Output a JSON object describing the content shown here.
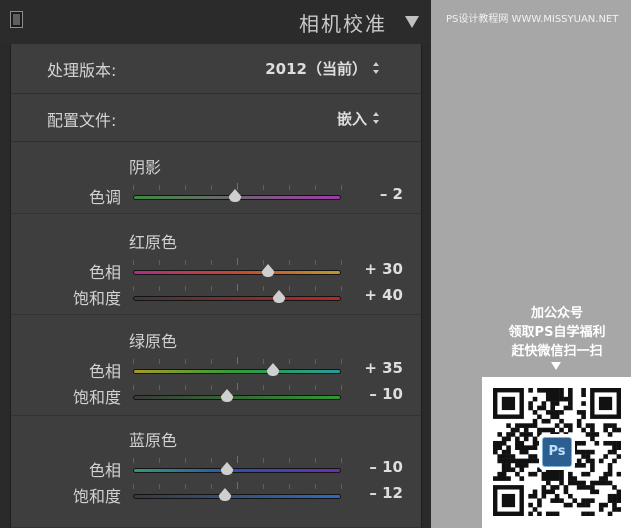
{
  "panel": {
    "title": "相机校准",
    "process_label": "处理版本:",
    "process_value": "2012（当前）",
    "profile_label": "配置文件:",
    "profile_value": "嵌入"
  },
  "sections": [
    {
      "title": "阴影",
      "sliders": [
        {
          "label": "色调",
          "value_text": "– 2",
          "value": -2,
          "min": -100,
          "max": 100,
          "track_colors": [
            "#3f8a3f",
            "#a03aa8"
          ]
        }
      ]
    },
    {
      "title": "红原色",
      "sliders": [
        {
          "label": "色相",
          "value_text": "+ 30",
          "value": 30,
          "min": -100,
          "max": 100,
          "track_colors": [
            "#a8307f",
            "#c8452e",
            "#b9992a"
          ]
        },
        {
          "label": "饱和度",
          "value_text": "+ 40",
          "value": 40,
          "min": -100,
          "max": 100,
          "track_colors": [
            "#3a3a3a",
            "#c02525"
          ]
        }
      ]
    },
    {
      "title": "绿原色",
      "sliders": [
        {
          "label": "色相",
          "value_text": "+ 35",
          "value": 35,
          "min": -100,
          "max": 100,
          "track_colors": [
            "#a79a25",
            "#2f9c3a",
            "#279c9c"
          ]
        },
        {
          "label": "饱和度",
          "value_text": "– 10",
          "value": -10,
          "min": -100,
          "max": 100,
          "track_colors": [
            "#3a3a3a",
            "#2f9a2f"
          ]
        }
      ]
    },
    {
      "title": "蓝原色",
      "sliders": [
        {
          "label": "色相",
          "value_text": "– 10",
          "value": -10,
          "min": -100,
          "max": 100,
          "track_colors": [
            "#2f9a7a",
            "#2e4fb0",
            "#6a2fb0"
          ]
        },
        {
          "label": "饱和度",
          "value_text": "– 12",
          "value": -12,
          "min": -100,
          "max": 100,
          "track_colors": [
            "#3a3a3a",
            "#2f6ac0"
          ]
        }
      ]
    }
  ],
  "watermark": "PS设计教程网 WWW.MISSYUAN.NET",
  "promo": {
    "line1": "加公众号",
    "line2": "领取PS自学福利",
    "line3": "赶快微信扫一扫"
  },
  "qr_logo": "Ps",
  "icons": {
    "collapse": "panel-collapse-box-icon",
    "disclosure": "triangle-down-icon",
    "stepper": "up-down-stepper-icon",
    "promo_arrow": "arrow-down-icon",
    "qr": "qr-code-icon"
  }
}
